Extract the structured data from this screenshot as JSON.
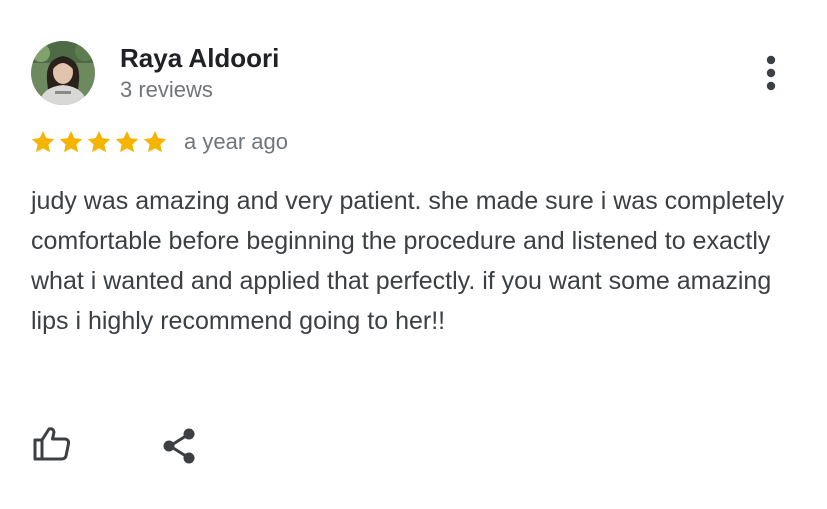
{
  "reviewer": {
    "name": "Raya Aldoori",
    "review_count": "3 reviews",
    "avatar_icon": "user-avatar-photo"
  },
  "rating": {
    "stars": 5,
    "max_stars": 5,
    "star_color": "#f4b400",
    "date": "a year ago"
  },
  "review": {
    "text": "judy was amazing and very patient. she made sure i was completely comfortable before beginning the procedure and listened to exactly what i wanted and applied that perfectly. if you want some amazing lips i highly recommend going to her!!"
  },
  "actions": {
    "more_icon": "more-vert-icon",
    "like_icon": "thumbs-up-icon",
    "share_icon": "share-icon"
  }
}
